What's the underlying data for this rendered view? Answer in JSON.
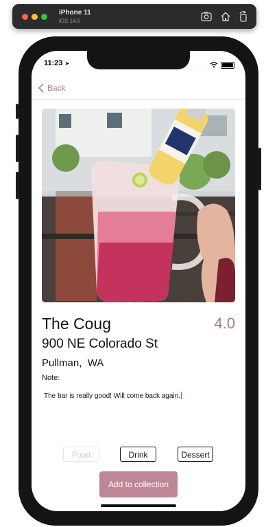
{
  "simulator": {
    "device": "iPhone 11",
    "os": "iOS 14.5",
    "icons": [
      "screenshot-icon",
      "home-icon",
      "rotate-icon"
    ]
  },
  "status_bar": {
    "time": "11:23",
    "signal": "....",
    "icons": [
      "location-arrow-icon",
      "wifi-icon",
      "battery-icon"
    ]
  },
  "nav": {
    "back_label": "Back"
  },
  "place": {
    "name": "The Coug",
    "rating": "4.0",
    "street": "900 NE Colorado St",
    "city_state": "Pullman,  WA",
    "note_label": "Note:",
    "note": "The bar is really good! Will come back again."
  },
  "categories": {
    "food": "Food",
    "drink": "Drink",
    "dessert": "Dessert"
  },
  "actions": {
    "add_label": "Add to collection"
  },
  "colors": {
    "accent": "#b07a8a",
    "rating": "#a97c8a",
    "add_button": "#bf8795"
  }
}
